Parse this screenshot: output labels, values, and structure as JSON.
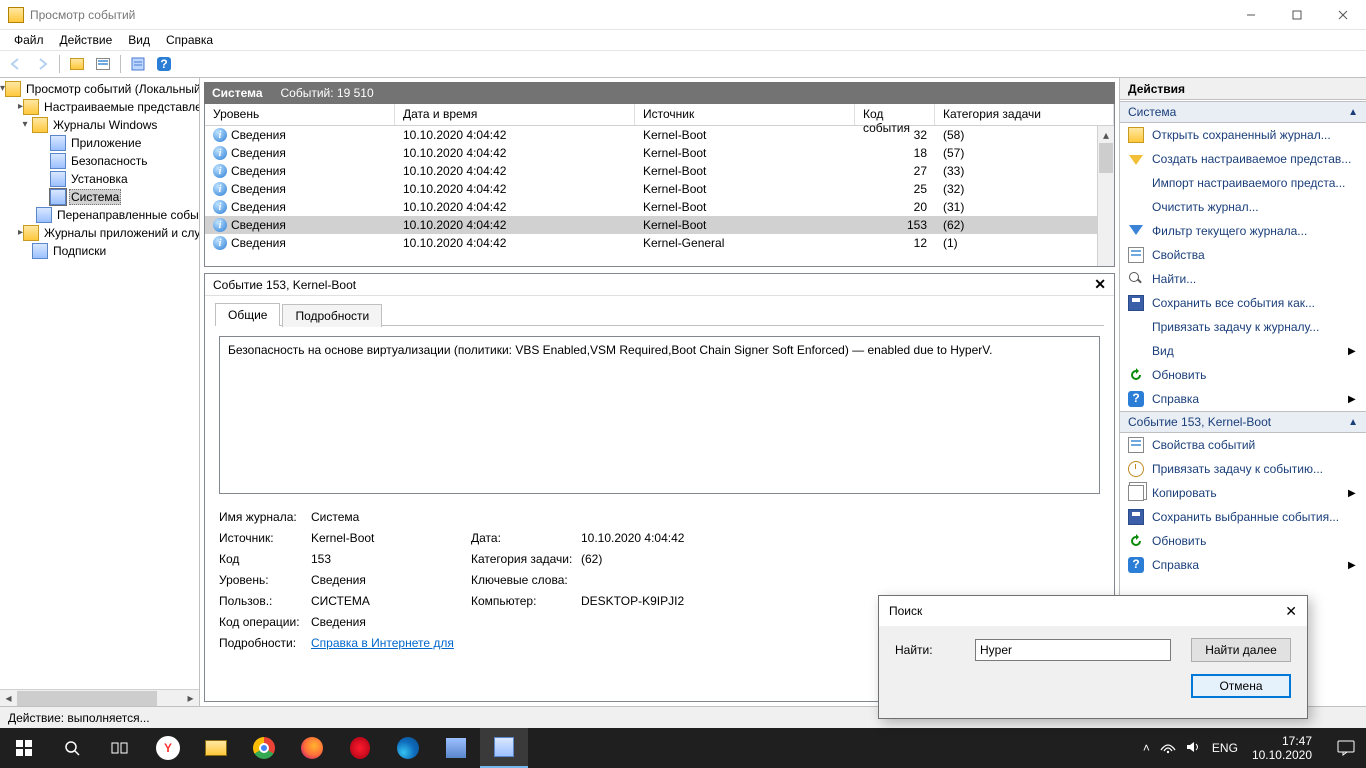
{
  "titlebar": {
    "title": "Просмотр событий"
  },
  "menubar": [
    "Файл",
    "Действие",
    "Вид",
    "Справка"
  ],
  "tree": {
    "root": "Просмотр событий (Локальный)",
    "items": [
      {
        "label": "Настраиваемые представления",
        "expanded": true
      },
      {
        "label": "Журналы Windows",
        "expanded": true,
        "children": [
          {
            "label": "Приложение"
          },
          {
            "label": "Безопасность"
          },
          {
            "label": "Установка"
          },
          {
            "label": "Система",
            "selected": true
          },
          {
            "label": "Перенаправленные события"
          }
        ]
      },
      {
        "label": "Журналы приложений и служб",
        "expanded": false
      },
      {
        "label": "Подписки"
      }
    ]
  },
  "list": {
    "title": "Система",
    "count_label": "Событий: 19 510",
    "columns": {
      "level": "Уровень",
      "date": "Дата и время",
      "source": "Источник",
      "event_id": "Код события",
      "category": "Категория задачи"
    },
    "rows": [
      {
        "level": "Сведения",
        "date": "10.10.2020 4:04:42",
        "source": "Kernel-Boot",
        "event_id": "32",
        "category": "(58)"
      },
      {
        "level": "Сведения",
        "date": "10.10.2020 4:04:42",
        "source": "Kernel-Boot",
        "event_id": "18",
        "category": "(57)"
      },
      {
        "level": "Сведения",
        "date": "10.10.2020 4:04:42",
        "source": "Kernel-Boot",
        "event_id": "27",
        "category": "(33)"
      },
      {
        "level": "Сведения",
        "date": "10.10.2020 4:04:42",
        "source": "Kernel-Boot",
        "event_id": "25",
        "category": "(32)"
      },
      {
        "level": "Сведения",
        "date": "10.10.2020 4:04:42",
        "source": "Kernel-Boot",
        "event_id": "20",
        "category": "(31)"
      },
      {
        "level": "Сведения",
        "date": "10.10.2020 4:04:42",
        "source": "Kernel-Boot",
        "event_id": "153",
        "category": "(62)",
        "selected": true
      },
      {
        "level": "Сведения",
        "date": "10.10.2020 4:04:42",
        "source": "Kernel-General",
        "event_id": "12",
        "category": "(1)"
      }
    ]
  },
  "detail": {
    "title": "Событие 153, Kernel-Boot",
    "tabs": {
      "general": "Общие",
      "details": "Подробности"
    },
    "description": "Безопасность на основе виртуализации (политики: VBS Enabled,VSM Required,Boot Chain Signer Soft Enforced) — enabled due to HyperV.",
    "labels": {
      "log_name": "Имя журнала:",
      "source": "Источник:",
      "date": "Дата:",
      "event_id": "Код",
      "category": "Категория задачи:",
      "level": "Уровень:",
      "keywords": "Ключевые слова:",
      "user": "Пользов.:",
      "computer": "Компьютер:",
      "opcode": "Код операции:",
      "more_info": "Подробности:"
    },
    "values": {
      "log_name": "Система",
      "source": "Kernel-Boot",
      "date": "10.10.2020 4:04:42",
      "event_id": "153",
      "category": "(62)",
      "level": "Сведения",
      "keywords": "",
      "user": "СИСТЕМА",
      "computer": "DESKTOP-K9IPJI2",
      "opcode": "Сведения",
      "more_info_link": "Справка в Интернете для "
    }
  },
  "actions": {
    "header": "Действия",
    "section1": {
      "title": "Система",
      "items": [
        {
          "label": "Открыть сохраненный журнал...",
          "icon": "open"
        },
        {
          "label": "Создать настраиваемое представ...",
          "icon": "funnel-new"
        },
        {
          "label": "Импорт настраиваемого предста...",
          "icon": ""
        },
        {
          "label": "Очистить журнал...",
          "icon": ""
        },
        {
          "label": "Фильтр текущего журнала...",
          "icon": "filter"
        },
        {
          "label": "Свойства",
          "icon": "prop"
        },
        {
          "label": "Найти...",
          "icon": "find"
        },
        {
          "label": "Сохранить все события как...",
          "icon": "save"
        },
        {
          "label": "Привязать задачу к журналу...",
          "icon": ""
        },
        {
          "label": "Вид",
          "icon": "",
          "sub": true
        },
        {
          "label": "Обновить",
          "icon": "refresh"
        },
        {
          "label": "Справка",
          "icon": "help",
          "sub": true
        }
      ]
    },
    "section2": {
      "title": "Событие 153, Kernel-Boot",
      "items": [
        {
          "label": "Свойства событий",
          "icon": "prop"
        },
        {
          "label": "Привязать задачу к событию...",
          "icon": "clock"
        },
        {
          "label": "Копировать",
          "icon": "copy",
          "sub": true
        },
        {
          "label": "Сохранить выбранные события...",
          "icon": "save"
        },
        {
          "label": "Обновить",
          "icon": "refresh"
        },
        {
          "label": "Справка",
          "icon": "help",
          "sub": true
        }
      ]
    }
  },
  "statusbar": {
    "text": "Действие: выполняется..."
  },
  "find_dialog": {
    "title": "Поиск",
    "label": "Найти:",
    "value": "Hyper",
    "find_next": "Найти далее",
    "cancel": "Отмена"
  },
  "taskbar": {
    "lang": "ENG",
    "time": "17:47",
    "date": "10.10.2020"
  }
}
